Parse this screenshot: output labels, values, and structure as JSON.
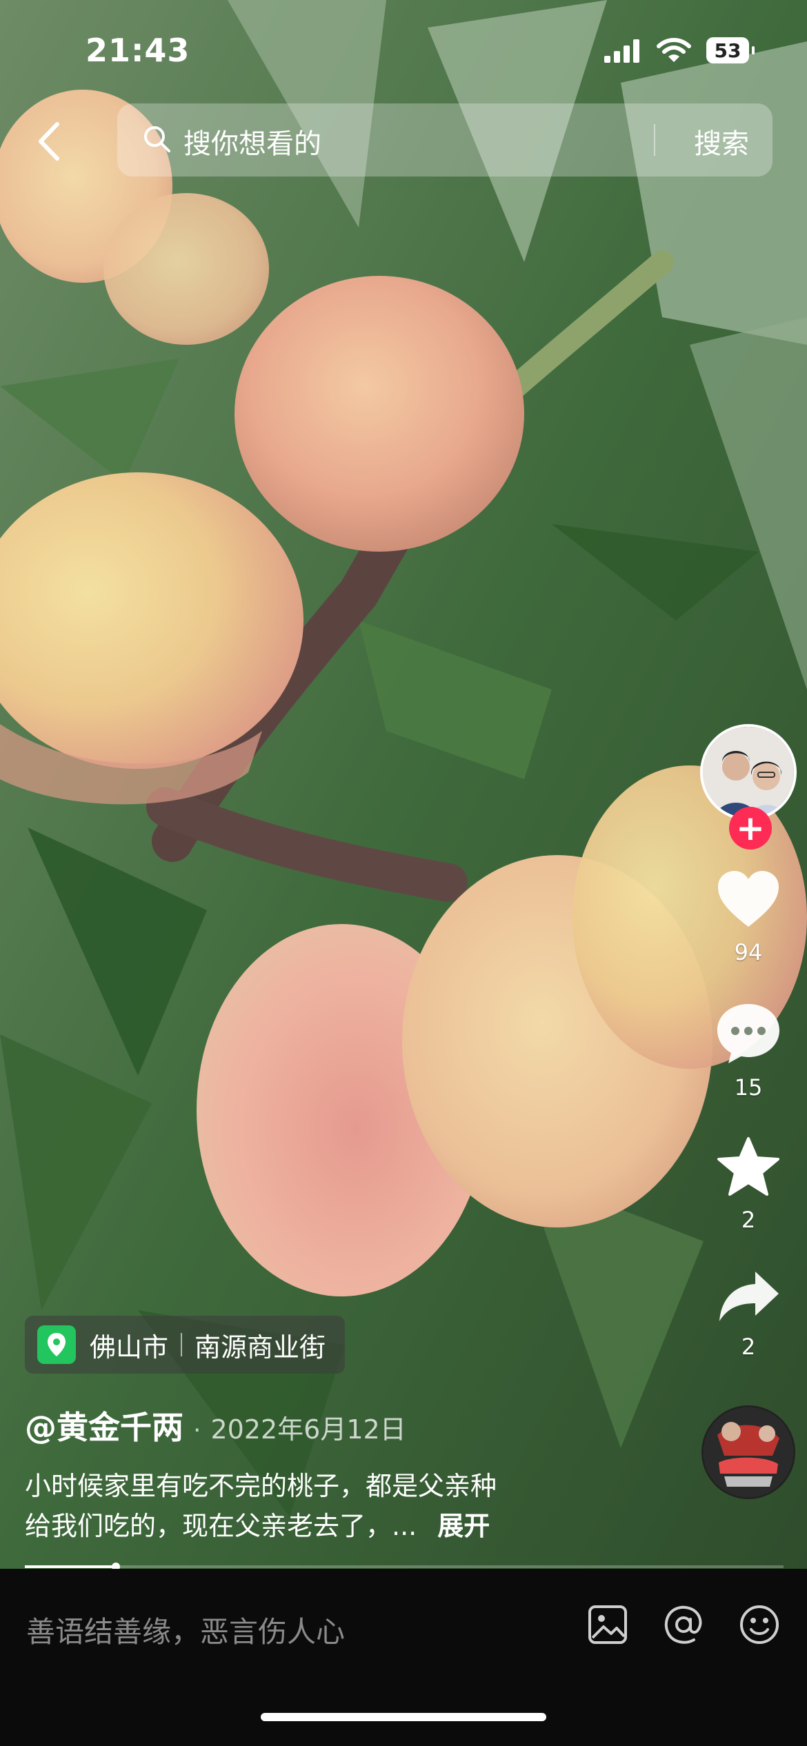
{
  "status_bar": {
    "time": "21:43",
    "battery": "53"
  },
  "search": {
    "placeholder": "搜你想看的",
    "button": "搜索"
  },
  "sidebar": {
    "likes": "94",
    "comments": "15",
    "favorites": "2",
    "shares": "2",
    "follow_symbol": "+"
  },
  "video": {
    "location_city": "佛山市",
    "location_place": "南源商业街",
    "author": "@黄金千两",
    "separator": "·",
    "date": "2022年6月12日",
    "description_line1": "小时候家里有吃不完的桃子，都是父亲种",
    "description_line2": "给我们吃的，现在父亲老去了，...",
    "expand": "展开",
    "progress": 0.12
  },
  "comment_bar": {
    "placeholder": "善语结善缘，恶言伤人心"
  },
  "icons": [
    "back-icon",
    "search-icon",
    "signal-icon",
    "wifi-icon",
    "battery-icon",
    "heart-icon",
    "comment-icon",
    "star-icon",
    "share-icon",
    "location-icon",
    "image-icon",
    "mention-icon",
    "emoji-icon"
  ]
}
